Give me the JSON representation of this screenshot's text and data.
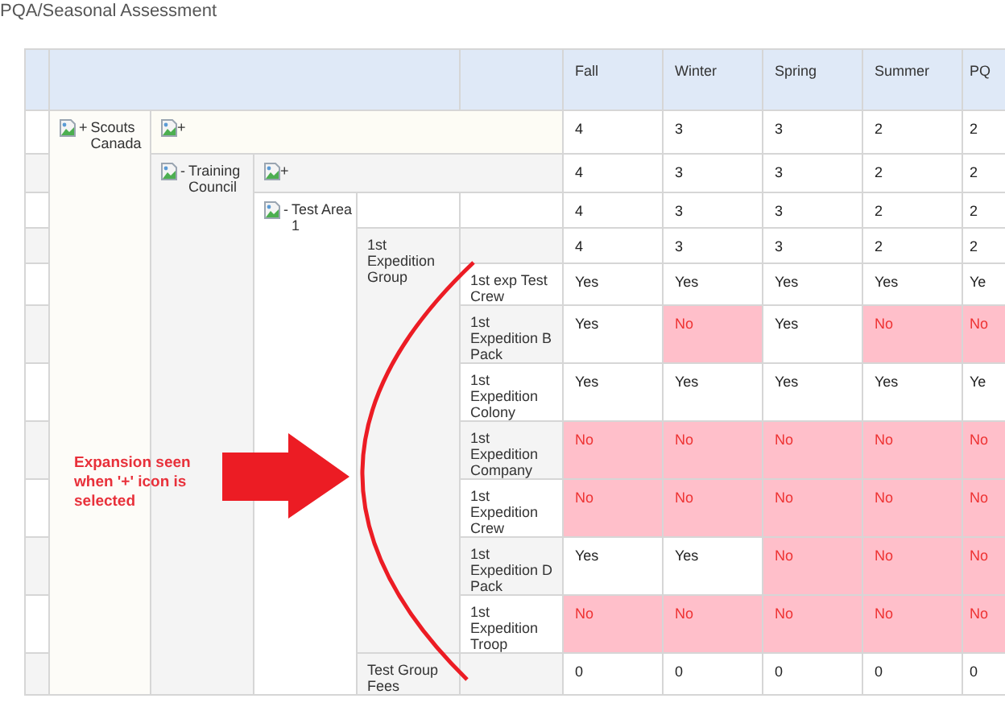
{
  "title": "PQA/Seasonal Assessment",
  "columns": [
    "Fall",
    "Winter",
    "Spring",
    "Summer",
    "PQ"
  ],
  "tree": [
    {
      "name": "Scouts Canada",
      "toggle": "+",
      "summary_toggle": "+",
      "values": [
        {
          "text": "4",
          "alert": false
        },
        {
          "text": "3",
          "alert": false
        },
        {
          "text": "3",
          "alert": false
        },
        {
          "text": "2",
          "alert": false
        },
        {
          "text": "2",
          "alert": false
        }
      ],
      "children": [
        {
          "name": "Training Council",
          "toggle": "-",
          "summary_toggle": "+",
          "values": [
            {
              "text": "4",
              "alert": false
            },
            {
              "text": "3",
              "alert": false
            },
            {
              "text": "3",
              "alert": false
            },
            {
              "text": "2",
              "alert": false
            },
            {
              "text": "2",
              "alert": false
            }
          ],
          "children": [
            {
              "name": "Test Area 1",
              "toggle": "-",
              "values": [
                {
                  "text": "4",
                  "alert": false
                },
                {
                  "text": "3",
                  "alert": false
                },
                {
                  "text": "3",
                  "alert": false
                },
                {
                  "text": "2",
                  "alert": false
                },
                {
                  "text": "2",
                  "alert": false
                }
              ],
              "children": [
                {
                  "name": "1st Expedition Group",
                  "values": [
                    {
                      "text": "4",
                      "alert": false
                    },
                    {
                      "text": "3",
                      "alert": false
                    },
                    {
                      "text": "3",
                      "alert": false
                    },
                    {
                      "text": "2",
                      "alert": false
                    },
                    {
                      "text": "2",
                      "alert": false
                    }
                  ],
                  "children": [
                    {
                      "name": "1st exp Test Crew",
                      "values": [
                        {
                          "text": "Yes",
                          "alert": false
                        },
                        {
                          "text": "Yes",
                          "alert": false
                        },
                        {
                          "text": "Yes",
                          "alert": false
                        },
                        {
                          "text": "Yes",
                          "alert": false
                        },
                        {
                          "text": "Ye",
                          "alert": false
                        }
                      ]
                    },
                    {
                      "name": "1st Expedition B Pack",
                      "values": [
                        {
                          "text": "Yes",
                          "alert": false
                        },
                        {
                          "text": "No",
                          "alert": true
                        },
                        {
                          "text": "Yes",
                          "alert": false
                        },
                        {
                          "text": "No",
                          "alert": true
                        },
                        {
                          "text": "No",
                          "alert": true
                        }
                      ]
                    },
                    {
                      "name": "1st Expedition Colony",
                      "values": [
                        {
                          "text": "Yes",
                          "alert": false
                        },
                        {
                          "text": "Yes",
                          "alert": false
                        },
                        {
                          "text": "Yes",
                          "alert": false
                        },
                        {
                          "text": "Yes",
                          "alert": false
                        },
                        {
                          "text": "Ye",
                          "alert": false
                        }
                      ]
                    },
                    {
                      "name": "1st Expedition Company",
                      "values": [
                        {
                          "text": "No",
                          "alert": true
                        },
                        {
                          "text": "No",
                          "alert": true
                        },
                        {
                          "text": "No",
                          "alert": true
                        },
                        {
                          "text": "No",
                          "alert": true
                        },
                        {
                          "text": "No",
                          "alert": true
                        }
                      ]
                    },
                    {
                      "name": "1st Expedition Crew",
                      "values": [
                        {
                          "text": "No",
                          "alert": true
                        },
                        {
                          "text": "No",
                          "alert": true
                        },
                        {
                          "text": "No",
                          "alert": true
                        },
                        {
                          "text": "No",
                          "alert": true
                        },
                        {
                          "text": "No",
                          "alert": true
                        }
                      ]
                    },
                    {
                      "name": "1st Expedition D Pack",
                      "values": [
                        {
                          "text": "Yes",
                          "alert": false
                        },
                        {
                          "text": "Yes",
                          "alert": false
                        },
                        {
                          "text": "No",
                          "alert": true
                        },
                        {
                          "text": "No",
                          "alert": true
                        },
                        {
                          "text": "No",
                          "alert": true
                        }
                      ]
                    },
                    {
                      "name": "1st Expedition Troop",
                      "values": [
                        {
                          "text": "No",
                          "alert": true
                        },
                        {
                          "text": "No",
                          "alert": true
                        },
                        {
                          "text": "No",
                          "alert": true
                        },
                        {
                          "text": "No",
                          "alert": true
                        },
                        {
                          "text": "No",
                          "alert": true
                        }
                      ]
                    }
                  ]
                },
                {
                  "name": "Test Group Fees",
                  "values": [
                    {
                      "text": "0",
                      "alert": false
                    },
                    {
                      "text": "0",
                      "alert": false
                    },
                    {
                      "text": "0",
                      "alert": false
                    },
                    {
                      "text": "0",
                      "alert": false
                    },
                    {
                      "text": "0",
                      "alert": false
                    }
                  ]
                }
              ]
            }
          ]
        }
      ]
    }
  ],
  "annotation": {
    "text": "Expansion seen when '+' icon is selected"
  }
}
